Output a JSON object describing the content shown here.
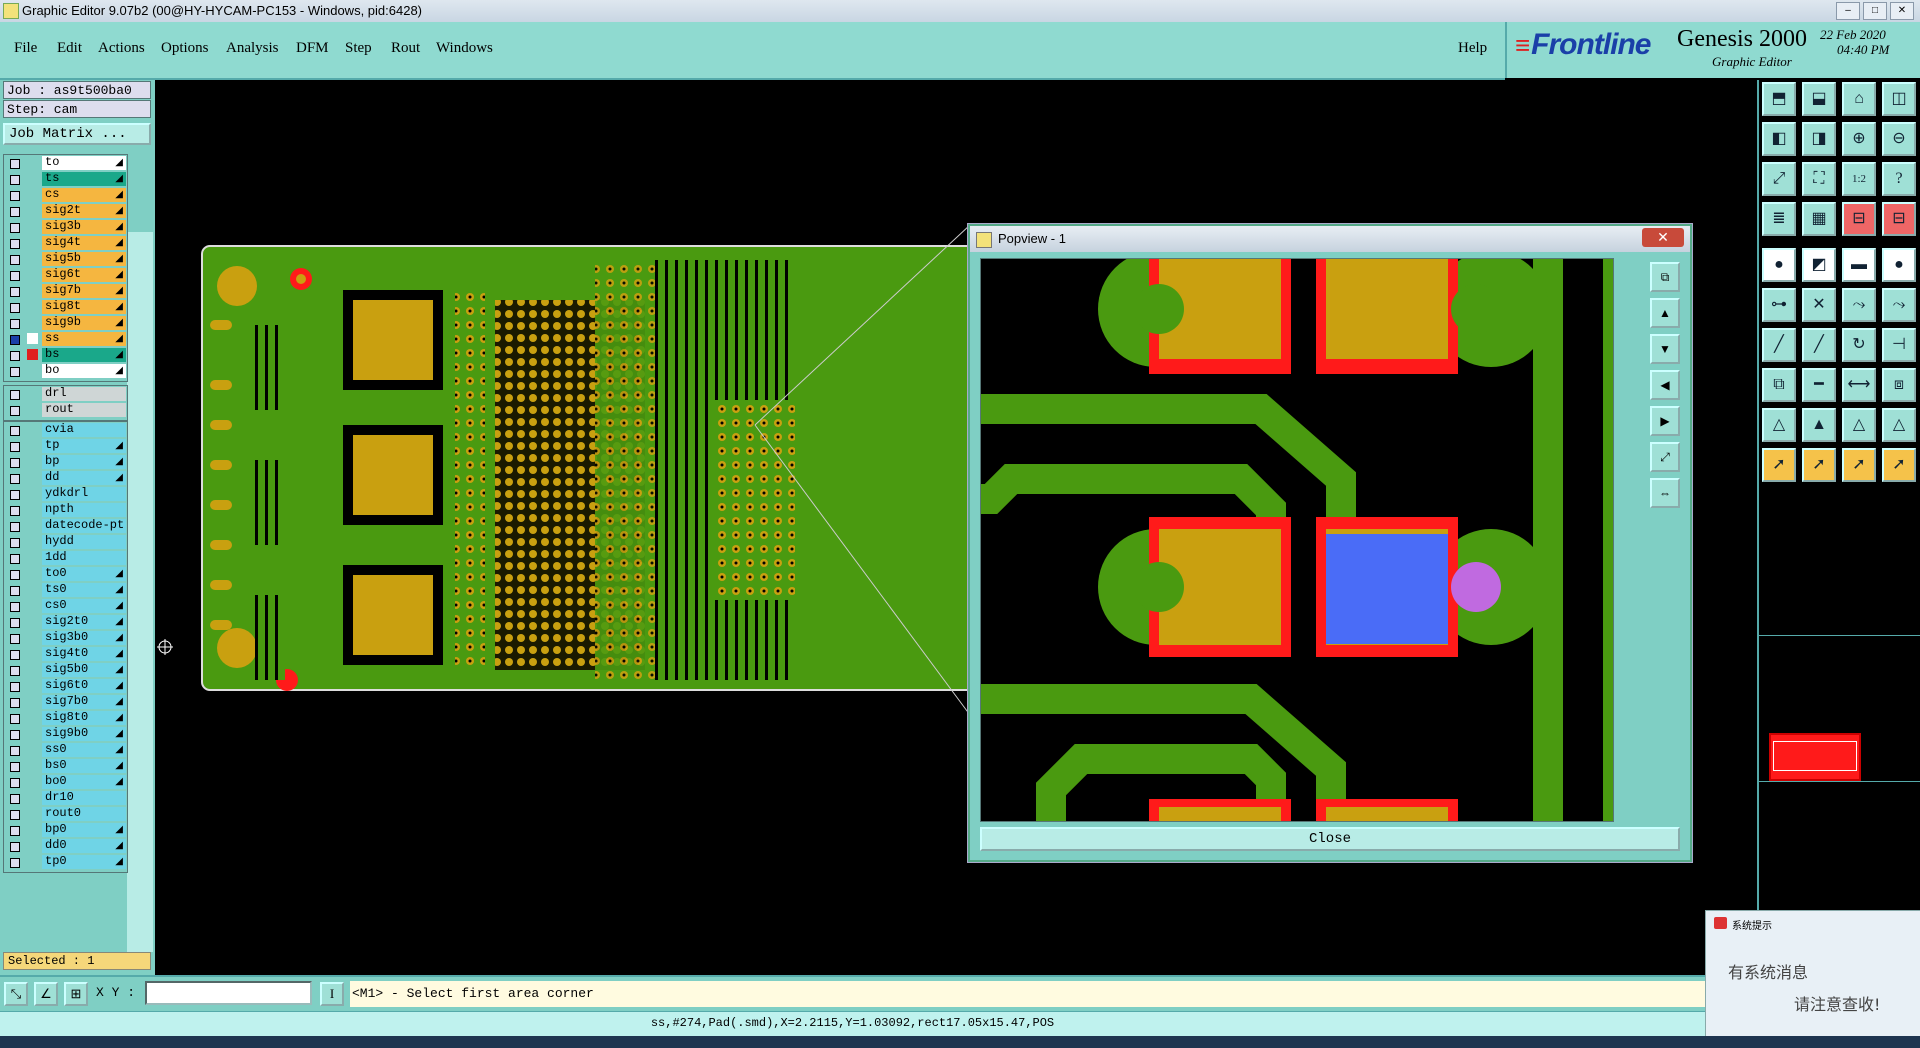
{
  "window": {
    "title": "Graphic Editor 9.07b2 (00@HY-HYCAM-PC153 - Windows, pid:6428)"
  },
  "menu": [
    "File",
    "Edit",
    "Actions",
    "Options",
    "Analysis",
    "DFM",
    "Step",
    "Rout",
    "Windows"
  ],
  "help_label": "Help",
  "brand": {
    "logo": "Frontline",
    "product": "Genesis 2000",
    "subtitle": "Graphic Editor",
    "date": "22 Feb 2020",
    "time": "04:40 PM"
  },
  "job": {
    "job_line": "Job : as9t500ba0",
    "step_line": "Step: cam",
    "matrix_button": "Job Matrix ..."
  },
  "layers_board": [
    {
      "name": "to",
      "bg": "#ffffff",
      "arrow": true
    },
    {
      "name": "ts",
      "bg": "#1aa88a",
      "arrow": true
    },
    {
      "name": "cs",
      "bg": "#f5b640",
      "arrow": true
    },
    {
      "name": "sig2t",
      "bg": "#f5b640",
      "arrow": true
    },
    {
      "name": "sig3b",
      "bg": "#f5b640",
      "arrow": true
    },
    {
      "name": "sig4t",
      "bg": "#f5b640",
      "arrow": true
    },
    {
      "name": "sig5b",
      "bg": "#f5b640",
      "arrow": true
    },
    {
      "name": "sig6t",
      "bg": "#f5b640",
      "arrow": true
    },
    {
      "name": "sig7b",
      "bg": "#f5b640",
      "arrow": true
    },
    {
      "name": "sig8t",
      "bg": "#f5b640",
      "arrow": true
    },
    {
      "name": "sig9b",
      "bg": "#f5b640",
      "arrow": true
    },
    {
      "name": "ss",
      "bg": "#f5b640",
      "arrow": true,
      "swatch": "#ffffff",
      "checked": true
    },
    {
      "name": "bs",
      "bg": "#1aa88a",
      "arrow": true,
      "swatch": "#e02020"
    },
    {
      "name": "bo",
      "bg": "#ffffff",
      "arrow": true
    }
  ],
  "layers_drill": [
    {
      "name": "drl",
      "bg": "#cfd6d6"
    },
    {
      "name": "rout",
      "bg": "#cfd6d6"
    }
  ],
  "layers_misc": [
    {
      "name": "cvia",
      "bg": "#6fd4e6"
    },
    {
      "name": "tp",
      "bg": "#6fd4e6",
      "arrow": true
    },
    {
      "name": "bp",
      "bg": "#6fd4e6",
      "arrow": true
    },
    {
      "name": "dd",
      "bg": "#6fd4e6",
      "arrow": true
    },
    {
      "name": "ydkdrl",
      "bg": "#6fd4e6"
    },
    {
      "name": "npth",
      "bg": "#6fd4e6"
    },
    {
      "name": "datecode-pt",
      "bg": "#6fd4e6"
    },
    {
      "name": "hydd",
      "bg": "#6fd4e6"
    },
    {
      "name": "1dd",
      "bg": "#6fd4e6"
    },
    {
      "name": "to0",
      "bg": "#6fd4e6",
      "arrow": true
    },
    {
      "name": "ts0",
      "bg": "#6fd4e6",
      "arrow": true
    },
    {
      "name": "cs0",
      "bg": "#6fd4e6",
      "arrow": true
    },
    {
      "name": "sig2t0",
      "bg": "#6fd4e6",
      "arrow": true
    },
    {
      "name": "sig3b0",
      "bg": "#6fd4e6",
      "arrow": true
    },
    {
      "name": "sig4t0",
      "bg": "#6fd4e6",
      "arrow": true
    },
    {
      "name": "sig5b0",
      "bg": "#6fd4e6",
      "arrow": true
    },
    {
      "name": "sig6t0",
      "bg": "#6fd4e6",
      "arrow": true
    },
    {
      "name": "sig7b0",
      "bg": "#6fd4e6",
      "arrow": true
    },
    {
      "name": "sig8t0",
      "bg": "#6fd4e6",
      "arrow": true
    },
    {
      "name": "sig9b0",
      "bg": "#6fd4e6",
      "arrow": true
    },
    {
      "name": "ss0",
      "bg": "#6fd4e6",
      "arrow": true
    },
    {
      "name": "bs0",
      "bg": "#6fd4e6",
      "arrow": true
    },
    {
      "name": "bo0",
      "bg": "#6fd4e6",
      "arrow": true
    },
    {
      "name": "dr10",
      "bg": "#6fd4e6"
    },
    {
      "name": "rout0",
      "bg": "#6fd4e6"
    },
    {
      "name": "bp0",
      "bg": "#6fd4e6",
      "arrow": true
    },
    {
      "name": "dd0",
      "bg": "#6fd4e6",
      "arrow": true
    },
    {
      "name": "tp0",
      "bg": "#6fd4e6",
      "arrow": true
    }
  ],
  "selected_label": "Selected : 1",
  "popview": {
    "title": "Popview - 1",
    "close_label": "Close"
  },
  "xy_label": "X Y :",
  "xy_value": "",
  "prompt_text": "<M1> - Select first area corner",
  "status_text": "ss,#274,Pad(.smd),X=2.2115,Y=1.03092,rect17.05x15.47,POS",
  "notification": {
    "title": "系统提示",
    "line1": "有系统消息",
    "line2": "请注意查收!"
  },
  "tool_icon_names": [
    "pan-up",
    "pan-down",
    "home",
    "split-view",
    "pan-left",
    "pan-right",
    "zoom-in",
    "zoom-out",
    "fit-screen",
    "fit-all",
    "ratio-1-2",
    "query",
    "layers",
    "grid",
    "snap-red",
    "snap-red-2",
    "select-point",
    "select-line",
    "ruler",
    "select-pad",
    "connect",
    "cross",
    "move",
    "pad-move",
    "draw-line",
    "draw-arc",
    "rotate",
    "mirror",
    "copy",
    "cut",
    "measure",
    "replace",
    "triangle",
    "arc-triangle",
    "arc-mark",
    "arc-flip",
    "pointer",
    "pointer-2",
    "pointer-3",
    "pointer-4"
  ],
  "colors": {
    "accent": "#8fdad0",
    "board_green": "#4a9a10",
    "copper": "#c9a010",
    "solder": "#ff1a1a",
    "selected_blue": "#4a6cf7"
  }
}
